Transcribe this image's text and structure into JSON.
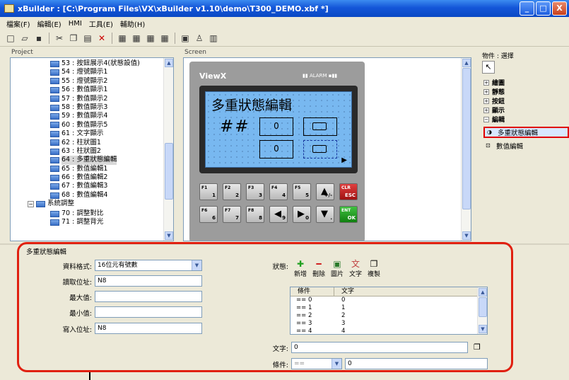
{
  "window": {
    "title": "xBuilder : [C:\\Program Files\\VX\\xBuilder v1.10\\demo\\T300_DEMO.xbf *]",
    "buttons": [
      "_",
      "□",
      "X"
    ]
  },
  "menu": [
    "檔案(F)",
    "編輯(E)",
    "HMI",
    "工具(E)",
    "輔助(H)"
  ],
  "toolbar_icons": [
    "new-icon",
    "open-icon",
    "save-icon",
    "cut-icon",
    "copy-icon",
    "paste-icon",
    "delete-icon",
    "tool1-icon",
    "tool2-icon",
    "tool3-icon",
    "tool4-icon",
    "tool5-icon",
    "tool6-icon",
    "tool7-icon"
  ],
  "panels": {
    "project": "Project",
    "screen": "Screen",
    "props_header": "物件 : 選擇"
  },
  "tree": [
    "53 : 按鈕展示4(狀態設值)",
    "54 : 燈號顯示1",
    "55 : 燈號顯示2",
    "56 : 數值顯示1",
    "57 : 數值顯示2",
    "58 : 數值顯示3",
    "59 : 數值顯示4",
    "60 : 數值顯示5",
    "61 : 文字顯示",
    "62 : 柱狀圖1",
    "63 : 柱狀圖2",
    "64 : 多重狀態編輯",
    "65 : 數值編輯1",
    "66 : 數值編輯2",
    "67 : 數值編輯3",
    "68 : 數值編輯4",
    "系統調整",
    "70 : 調整對比",
    "71 : 調整背光"
  ],
  "device": {
    "brand": "ViewX",
    "alarm": "ALARM",
    "lcd_title": "多重狀態編輯",
    "lcd_hash": "##",
    "box1": "0",
    "box2": "0",
    "keys_top": [
      {
        "l": "F1",
        "r": "1"
      },
      {
        "l": "F2",
        "r": "2"
      },
      {
        "l": "F3",
        "r": "3"
      },
      {
        "l": "F4",
        "r": "4"
      },
      {
        "l": "F5",
        "r": "5"
      },
      {
        "l": "",
        "r": "+/-"
      },
      {
        "l": "CLR",
        "r": "ESC"
      }
    ],
    "keys_bottom": [
      {
        "l": "F6",
        "r": "6"
      },
      {
        "l": "F7",
        "r": "7"
      },
      {
        "l": "F8",
        "r": "8"
      },
      {
        "l": "",
        "r": "9"
      },
      {
        "l": "",
        "r": "0"
      },
      {
        "l": "",
        "r": "."
      },
      {
        "l": "ENT",
        "r": "OK"
      }
    ]
  },
  "props": {
    "categories": [
      "繪圖",
      "靜態",
      "按鈕",
      "顯示",
      "編輯"
    ],
    "edit_items": [
      "多重狀態編輯",
      "數值編輯"
    ]
  },
  "editor": {
    "title": "多重狀態編輯",
    "fields": [
      {
        "label": "資料格式:",
        "value": "16位元有號數"
      },
      {
        "label": "讀取位址:",
        "value": "N8"
      },
      {
        "label": "最大值:",
        "value": ""
      },
      {
        "label": "最小值:",
        "value": ""
      },
      {
        "label": "寫入位址:",
        "value": "N8"
      }
    ],
    "state_label": "狀態:",
    "state_buttons": [
      "新增",
      "刪除",
      "圖片",
      "文字",
      "複製"
    ],
    "table_headers": [
      "條件",
      "文字"
    ],
    "table_rows": [
      {
        "cond": "== 0",
        "text": "0"
      },
      {
        "cond": "== 1",
        "text": "1"
      },
      {
        "cond": "== 2",
        "text": "2"
      },
      {
        "cond": "== 3",
        "text": "3"
      },
      {
        "cond": "== 4",
        "text": "4"
      }
    ],
    "text_label": "文字:",
    "text_value": "0",
    "cond_label": "條件:",
    "cond_op": "==",
    "cond_value": "0"
  }
}
